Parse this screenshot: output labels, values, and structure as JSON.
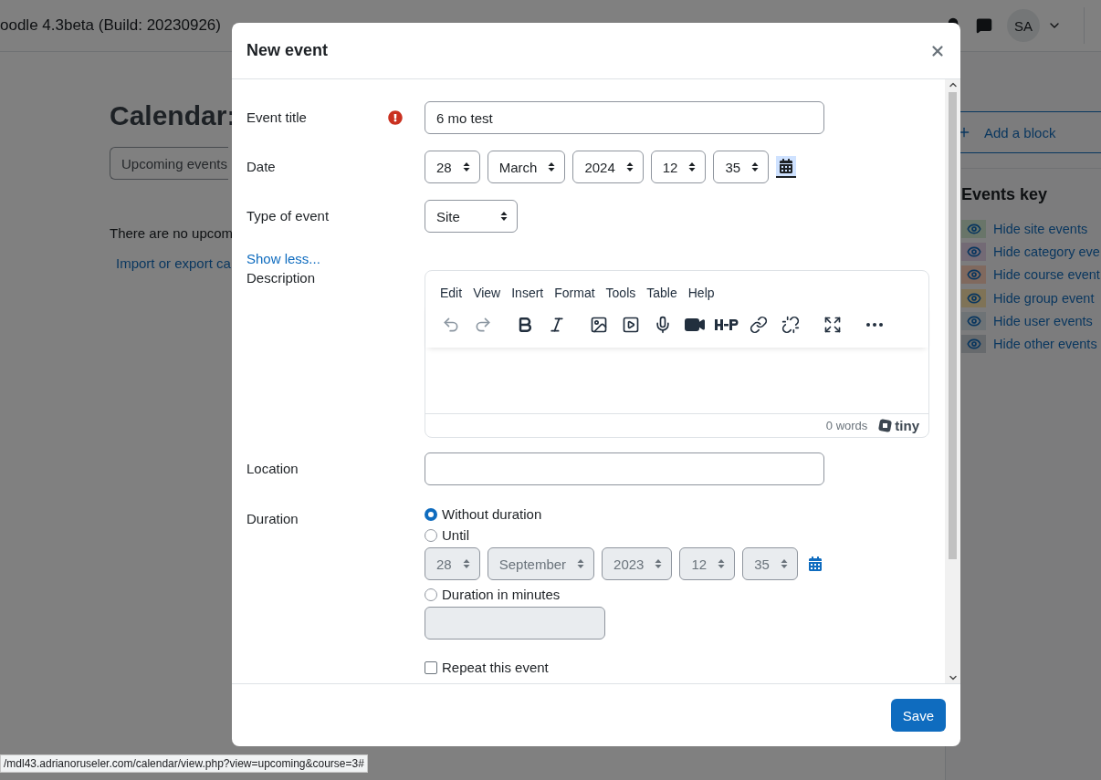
{
  "page": {
    "site_title": "oodle 4.3beta (Build: 20230926)",
    "avatar": "SA",
    "heading": "Calendar:",
    "view_button": "Upcoming events",
    "empty_message": "There are no upcom",
    "import_link": "Import or export ca",
    "add_block": "Add a block",
    "events_key": {
      "title": "Events key",
      "items": [
        {
          "label": "Hide site events",
          "color": "#697569"
        },
        {
          "label": "Hide category eve",
          "color": "#736a75"
        },
        {
          "label": "Hide course event",
          "color": "#80695e"
        },
        {
          "label": "Hide group event",
          "color": "#7f7357"
        },
        {
          "label": "Hide user events",
          "color": "#6e7376"
        },
        {
          "label": "Hide other events",
          "color": "#676a6d"
        }
      ]
    }
  },
  "dialog": {
    "title": "New event",
    "event_title": {
      "label": "Event title",
      "required": true,
      "value": "6 mo test"
    },
    "date": {
      "label": "Date",
      "selects": [
        "28",
        "March",
        "2024",
        "12",
        "35"
      ],
      "disabled": false,
      "calendar_focused": true
    },
    "type": {
      "label": "Type of event",
      "value": "Site"
    },
    "show_less": "Show less...",
    "description": {
      "label": "Description",
      "menus": [
        "Edit",
        "View",
        "Insert",
        "Format",
        "Tools",
        "Table",
        "Help"
      ],
      "toolbar": [
        [
          {
            "kind": "undo",
            "disabled": true
          },
          {
            "kind": "redo",
            "disabled": true
          }
        ],
        [
          {
            "kind": "bold",
            "disabled": false
          },
          {
            "kind": "italic",
            "disabled": false
          }
        ],
        [
          {
            "kind": "image",
            "disabled": false
          },
          {
            "kind": "media",
            "disabled": false
          },
          {
            "kind": "mic",
            "disabled": false
          },
          {
            "kind": "video",
            "disabled": false
          },
          {
            "kind": "h5p",
            "disabled": false
          },
          {
            "kind": "link",
            "disabled": false
          },
          {
            "kind": "unlink",
            "disabled": false
          }
        ],
        [
          {
            "kind": "fullscreen",
            "disabled": false
          }
        ],
        [
          {
            "kind": "more",
            "disabled": false
          }
        ]
      ],
      "word_count": "0 words",
      "brand": "tiny"
    },
    "location": {
      "label": "Location"
    },
    "duration": {
      "label": "Duration",
      "options": [
        {
          "label": "Without duration",
          "selected": true
        },
        {
          "label": "Until",
          "selected": false
        },
        {
          "label": "Duration in minutes",
          "selected": false
        }
      ],
      "until": {
        "selects": [
          "28",
          "September",
          "2023",
          "12",
          "35"
        ],
        "disabled": true,
        "calendar_focused": false
      },
      "minutes_disabled": true
    },
    "repeat": {
      "label": "Repeat this event",
      "checked": false
    },
    "save": "Save"
  },
  "status_url": "/mdl43.adrianoruseler.com/calendar/view.php?view=upcoming&course=3#"
}
